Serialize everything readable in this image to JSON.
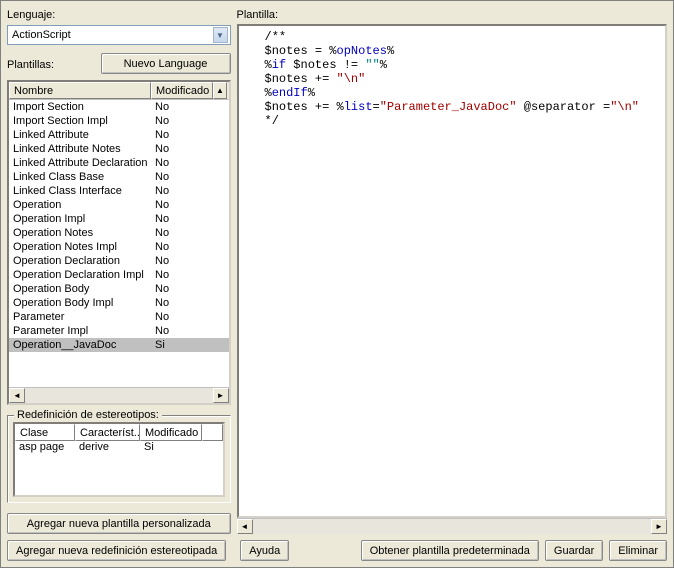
{
  "labels": {
    "lenguaje": "Lenguaje:",
    "plantillas": "Plantillas:",
    "plantilla": "Plantilla:",
    "redef": "Redefinición de estereotipos:"
  },
  "language": "ActionScript",
  "buttons": {
    "nuevo_language": "Nuevo Language",
    "agregar_plantilla": "Agregar nueva plantilla personalizada",
    "agregar_redef": "Agregar nueva redefinición estereotipada",
    "ayuda": "Ayuda",
    "obtener": "Obtener plantilla predeterminada",
    "guardar": "Guardar",
    "eliminar": "Eliminar"
  },
  "list": {
    "headers": {
      "nombre": "Nombre",
      "modificado": "Modificado"
    },
    "rows": [
      {
        "n": "Import Section",
        "m": "No",
        "sel": false
      },
      {
        "n": "Import Section Impl",
        "m": "No",
        "sel": false
      },
      {
        "n": "Linked Attribute",
        "m": "No",
        "sel": false
      },
      {
        "n": "Linked Attribute Notes",
        "m": "No",
        "sel": false
      },
      {
        "n": "Linked Attribute Declaration",
        "m": "No",
        "sel": false
      },
      {
        "n": "Linked Class Base",
        "m": "No",
        "sel": false
      },
      {
        "n": "Linked Class Interface",
        "m": "No",
        "sel": false
      },
      {
        "n": "Operation",
        "m": "No",
        "sel": false
      },
      {
        "n": "Operation Impl",
        "m": "No",
        "sel": false
      },
      {
        "n": "Operation Notes",
        "m": "No",
        "sel": false
      },
      {
        "n": "Operation Notes Impl",
        "m": "No",
        "sel": false
      },
      {
        "n": "Operation Declaration",
        "m": "No",
        "sel": false
      },
      {
        "n": "Operation Declaration Impl",
        "m": "No",
        "sel": false
      },
      {
        "n": "Operation Body",
        "m": "No",
        "sel": false
      },
      {
        "n": "Operation Body Impl",
        "m": "No",
        "sel": false
      },
      {
        "n": "Parameter",
        "m": "No",
        "sel": false
      },
      {
        "n": "Parameter Impl",
        "m": "No",
        "sel": false
      },
      {
        "n": "Operation__JavaDoc",
        "m": "Si",
        "sel": true
      }
    ]
  },
  "stereo": {
    "headers": {
      "clase": "Clase",
      "caract": "Característ...",
      "mod": "Modificado"
    },
    "rows": [
      {
        "c": "asp page",
        "f": "derive",
        "m": "Si"
      }
    ]
  },
  "code": {
    "l1": "/**",
    "l2a": "$notes = %",
    "l2b": "opNotes",
    "l2c": "%",
    "l3a": "%",
    "l3b": "if",
    "l3c": " $notes != ",
    "l3d": "\"\"",
    "l3e": "%",
    "l4a": "$notes += ",
    "l4b": "\"\\n\"",
    "l5a": "%",
    "l5b": "endIf",
    "l5c": "%",
    "l6a": "$notes += %",
    "l6b": "list",
    "l6c": "=",
    "l6d": "\"Parameter_JavaDoc\"",
    "l6e": " @separator =",
    "l6f": "\"\\n\"",
    "l7": "*/"
  }
}
